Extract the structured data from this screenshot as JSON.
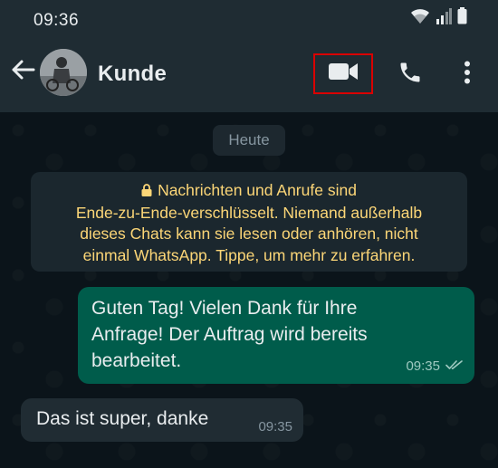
{
  "status_bar": {
    "time": "09:36",
    "icons": [
      "wifi-icon",
      "signal-icon",
      "battery-icon"
    ]
  },
  "header": {
    "back_icon": "arrow-left-icon",
    "contact_name": "Kunde",
    "actions": [
      {
        "icon": "video-call-icon",
        "highlighted": true,
        "highlight_color": "#d90000"
      },
      {
        "icon": "phone-icon"
      },
      {
        "icon": "more-vert-icon"
      }
    ]
  },
  "chat": {
    "date_chip": "Heute",
    "encryption_notice": {
      "icon": "lock-icon",
      "lines": [
        "Nachrichten und Anrufe sind",
        "Ende-zu-Ende-verschlüsselt. Niemand außerhalb",
        "dieses Chats kann sie lesen oder anhören, nicht",
        "einmal WhatsApp. Tippe, um mehr zu erfahren."
      ]
    },
    "messages": [
      {
        "direction": "outgoing",
        "lines": [
          "Guten Tag! Vielen Dank für Ihre",
          "Anfrage! Der Auftrag wird bereits",
          "bearbeitet."
        ],
        "time": "09:35",
        "status_icon": "double-check-icon"
      },
      {
        "direction": "incoming",
        "text": "Das ist super, danke",
        "time": "09:35"
      }
    ]
  },
  "colors": {
    "header_bg": "#1f2c33",
    "chat_bg": "#0b141a",
    "outgoing_bubble": "#005c4b",
    "incoming_bubble": "#202c33",
    "notice_text": "#fcd677"
  }
}
